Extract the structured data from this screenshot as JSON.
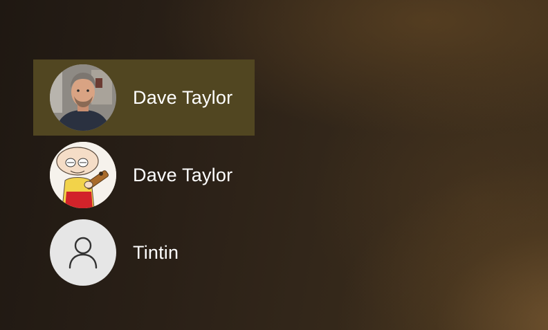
{
  "users": [
    {
      "name": "Dave Taylor",
      "avatar_icon": "user-photo-icon",
      "selected": true
    },
    {
      "name": "Dave Taylor",
      "avatar_icon": "cartoon-avatar-icon",
      "selected": false
    },
    {
      "name": "Tintin",
      "avatar_icon": "person-silhouette-icon",
      "selected": false
    }
  ],
  "colors": {
    "selected_background": "#514621",
    "text": "#ffffff",
    "generic_avatar_background": "#e6e6e6"
  }
}
